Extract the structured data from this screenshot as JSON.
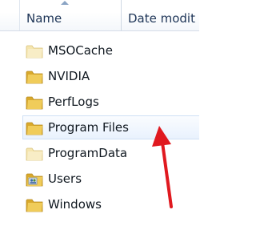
{
  "header": {
    "name_label": "Name",
    "date_label": "Date modit"
  },
  "items": [
    {
      "label": "MSOCache",
      "icon": "folder-faded-icon"
    },
    {
      "label": "NVIDIA",
      "icon": "folder-icon"
    },
    {
      "label": "PerfLogs",
      "icon": "folder-icon"
    },
    {
      "label": "Program Files",
      "icon": "folder-icon",
      "selected": true
    },
    {
      "label": "ProgramData",
      "icon": "folder-faded-icon"
    },
    {
      "label": "Users",
      "icon": "users-folder-icon"
    },
    {
      "label": "Windows",
      "icon": "folder-icon"
    }
  ],
  "colors": {
    "annotation_arrow": "#e0191f",
    "folder": "#e7c24a",
    "header_text": "#1e3557"
  }
}
